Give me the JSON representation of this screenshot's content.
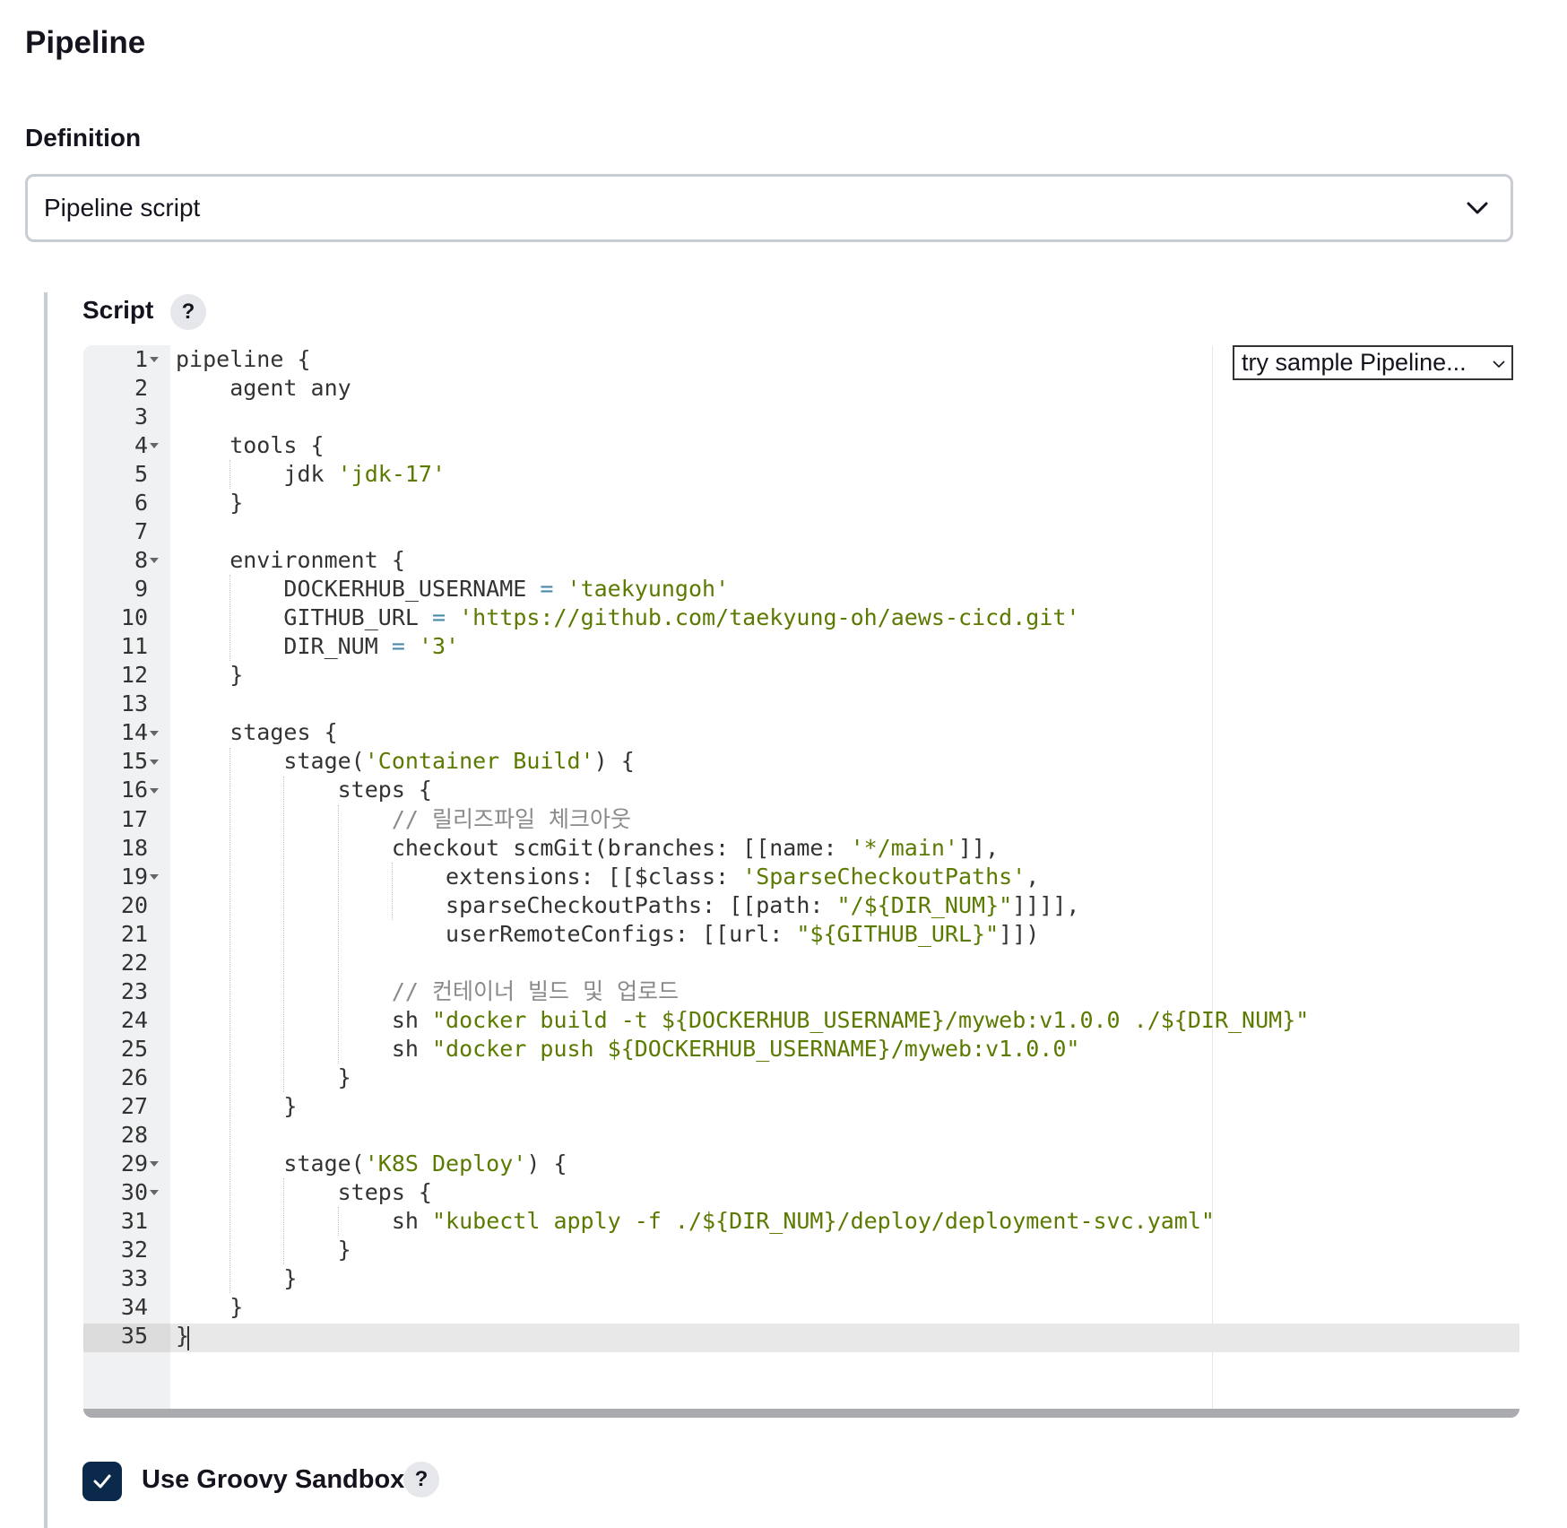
{
  "section_title": "Pipeline",
  "definition": {
    "label": "Definition",
    "selected": "Pipeline script"
  },
  "script": {
    "label": "Script",
    "help_label": "?",
    "sample_select": "try sample Pipeline...",
    "lines": [
      "pipeline {",
      "    agent any",
      "",
      "    tools {",
      "        jdk 'jdk-17'",
      "    }",
      "",
      "    environment {",
      "        DOCKERHUB_USERNAME = 'taekyungoh'",
      "        GITHUB_URL = 'https://github.com/taekyung-oh/aews-cicd.git'",
      "        DIR_NUM = '3'",
      "    }",
      "",
      "    stages {",
      "        stage('Container Build') {",
      "            steps {",
      "                // 릴리즈파일 체크아웃",
      "                checkout scmGit(branches: [[name: '*/main']],",
      "                    extensions: [[$class: 'SparseCheckoutPaths',",
      "                    sparseCheckoutPaths: [[path: \"/${DIR_NUM}\"]]]],",
      "                    userRemoteConfigs: [[url: \"${GITHUB_URL}\"]])",
      "",
      "                // 컨테이너 빌드 및 업로드",
      "                sh \"docker build -t ${DOCKERHUB_USERNAME}/myweb:v1.0.0 ./${DIR_NUM}\"",
      "                sh \"docker push ${DOCKERHUB_USERNAME}/myweb:v1.0.0\"",
      "            }",
      "        }",
      "",
      "        stage('K8S Deploy') {",
      "            steps {",
      "                sh \"kubectl apply -f ./${DIR_NUM}/deploy/deployment-svc.yaml\"",
      "            }",
      "        }",
      "    }",
      "}"
    ],
    "fold_lines": [
      1,
      4,
      8,
      14,
      15,
      16,
      19,
      29,
      30
    ],
    "active_line": 35
  },
  "sandbox": {
    "label": "Use Groovy Sandbox",
    "checked": true,
    "help_label": "?"
  },
  "colors": {
    "string": "#5b7a00",
    "comment": "#8a8a8a",
    "operator": "#4a8aa8",
    "text": "#333333",
    "checkbox": "#0b2a4b"
  }
}
